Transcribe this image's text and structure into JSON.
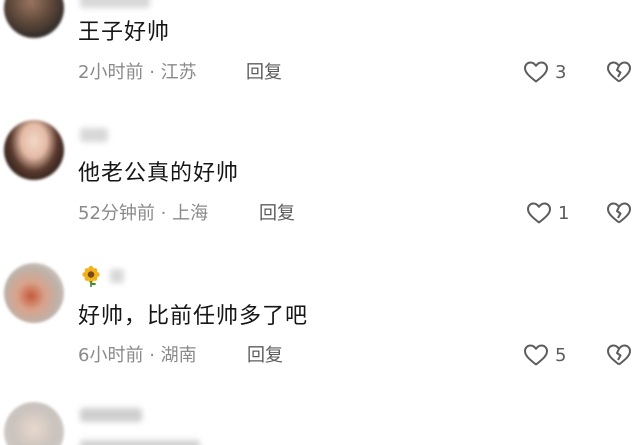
{
  "comments": [
    {
      "text": "王子好帅",
      "time": "2小时前",
      "sep": "·",
      "location": "江苏",
      "reply_label": "回复",
      "likes": "3"
    },
    {
      "text": "他老公真的好帅",
      "time": "52分钟前",
      "sep": "·",
      "location": "上海",
      "reply_label": "回复",
      "likes": "1"
    },
    {
      "text": "好帅，比前任帅多了吧",
      "time": "6小时前",
      "sep": "·",
      "location": "湖南",
      "reply_label": "回复",
      "likes": "5"
    },
    {
      "text": "",
      "time": "",
      "location": "",
      "reply_label": "",
      "likes": ""
    }
  ],
  "icons": {
    "like": "heart-outline-icon",
    "dislike": "broken-heart-icon",
    "badge": "sunflower-icon"
  },
  "colors": {
    "text": "#161616",
    "meta": "#8a8a8a",
    "action": "#5c5c5c",
    "background": "#ffffff"
  }
}
